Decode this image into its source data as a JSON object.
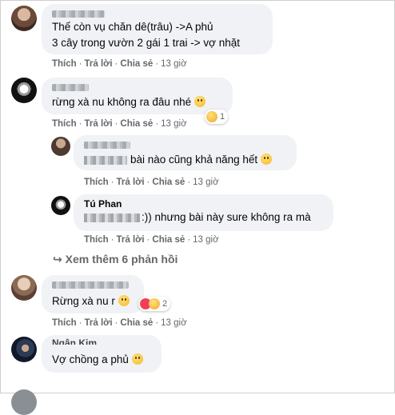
{
  "comments": [
    {
      "lines": [
        "Thế còn vụ chăn dê(trâu) ->A phủ",
        "3 cây trong vườn 2 gái 1 trai -> vợ nhặt"
      ],
      "actions": {
        "like": "Thích",
        "reply": "Trả lời",
        "share": "Chia sẻ",
        "time": "13 giờ"
      }
    },
    {
      "lines": [
        "rừng xà nu không ra đâu nhé"
      ],
      "reaction_count": "1",
      "actions": {
        "like": "Thích",
        "reply": "Trả lời",
        "share": "Chia sẻ",
        "time": "13 giờ"
      },
      "replies": [
        {
          "text": "bài nào cũng khả năng hết",
          "actions": {
            "like": "Thích",
            "reply": "Trả lời",
            "share": "Chia sẻ",
            "time": "13 giờ"
          }
        },
        {
          "author": "Tú Phan",
          "text": ":)) nhưng bài này sure không ra mà",
          "actions": {
            "like": "Thích",
            "reply": "Trả lời",
            "share": "Chia sẻ",
            "time": "13 giờ"
          }
        }
      ],
      "more_replies": "Xem thêm 6 phản hồi"
    },
    {
      "lines": [
        "Rừng xà nu r"
      ],
      "reaction_count": "2",
      "actions": {
        "like": "Thích",
        "reply": "Trả lời",
        "share": "Chia sẻ",
        "time": "13 giờ"
      }
    },
    {
      "author_partial": "Ngân Kim",
      "lines": [
        "Vợ chồng a phủ"
      ]
    }
  ],
  "colors": {
    "bubble": "#f0f2f5",
    "action_text": "#65676b",
    "text": "#050505"
  }
}
